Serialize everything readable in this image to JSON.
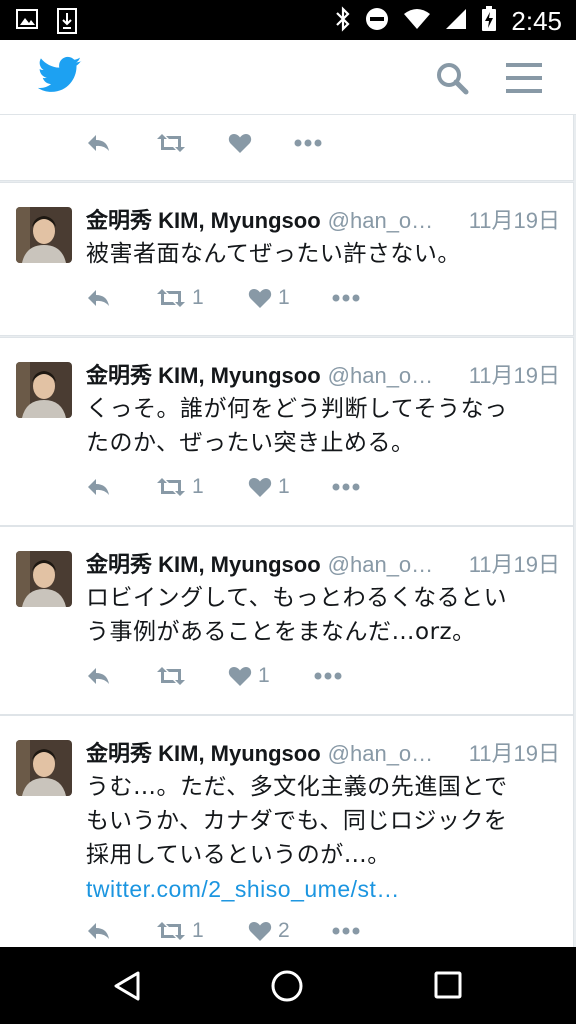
{
  "status_bar": {
    "time": "2:45"
  },
  "feed": {
    "tweets": [
      {
        "name": "金明秀 KIM, Myungsoo",
        "handle": "@han_o…",
        "date": "11月19日",
        "lines": [
          "被害者面なんてぜったい許さない。"
        ],
        "retweets": "1",
        "likes": "1"
      },
      {
        "name": "金明秀 KIM, Myungsoo",
        "handle": "@han_o…",
        "date": "11月19日",
        "lines": [
          "くっそ。誰が何をどう判断してそうなっ",
          "たのか、ぜったい突き止める。"
        ],
        "retweets": "1",
        "likes": "1"
      },
      {
        "name": "金明秀 KIM, Myungsoo",
        "handle": "@han_o…",
        "date": "11月19日",
        "lines": [
          "ロビイングして、もっとわるくなるとい",
          "う事例があることをまなんだ…orz。"
        ],
        "retweets": "",
        "likes": "1"
      },
      {
        "name": "金明秀 KIM, Myungsoo",
        "handle": "@han_o…",
        "date": "11月19日",
        "lines": [
          "うむ…。ただ、多文化主義の先進国とで",
          "もいうか、カナダでも、同じロジックを",
          "採用しているというのが…。"
        ],
        "link": "twitter.com/2_shiso_ume/st…",
        "retweets": "1",
        "likes": "2"
      }
    ]
  },
  "icons": {
    "brand": "twitter-bird-icon",
    "search": "search-icon",
    "menu": "hamburger-menu-icon",
    "reply": "reply-icon",
    "retweet": "retweet-icon",
    "like": "heart-icon",
    "more": "more-icon"
  },
  "colors": {
    "brand_blue": "#1da1f2",
    "link_blue": "#1b95e0",
    "icon_gray": "#8899a6",
    "text": "#14171a"
  }
}
